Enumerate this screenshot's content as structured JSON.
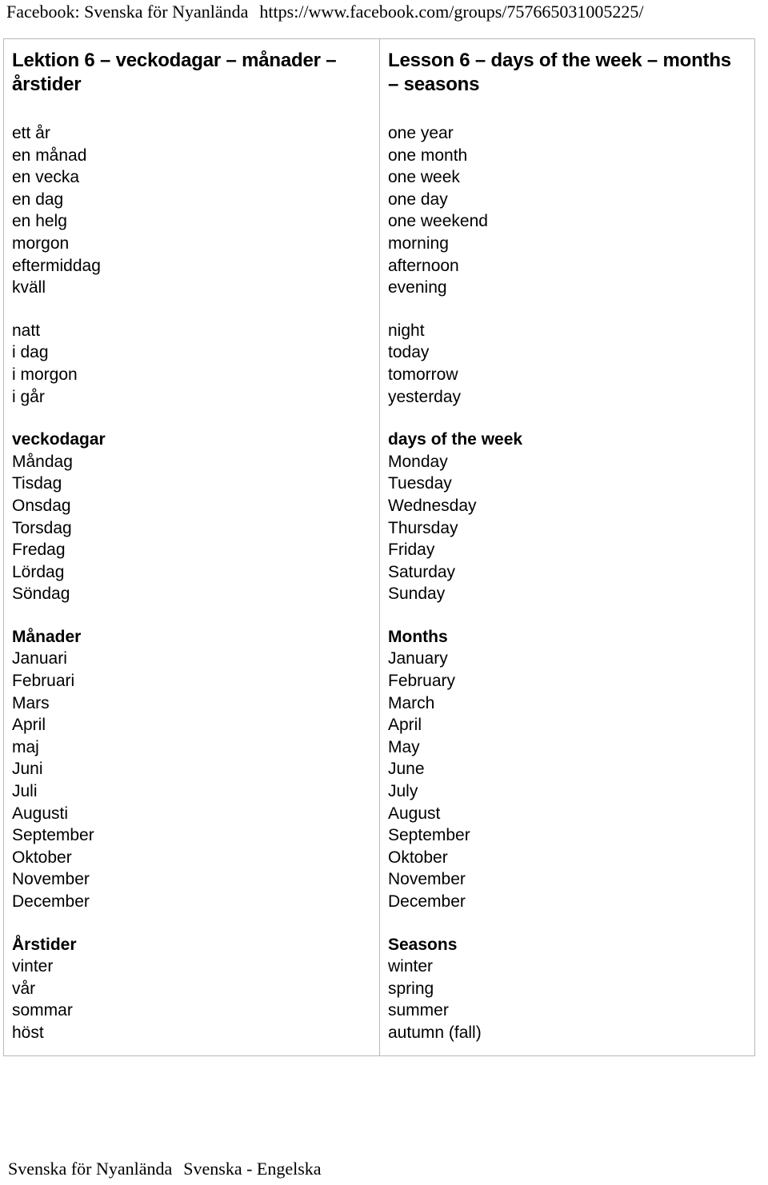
{
  "header": {
    "site_label": "Facebook: Svenska för Nyanlända",
    "url": "https://www.facebook.com/groups/757665031005225/"
  },
  "table": {
    "left_column": {
      "title": "Lektion 6 – veckodagar – månader – årstider",
      "blocks": [
        {
          "heading": null,
          "items": [
            "ett år",
            "en månad",
            "en vecka",
            "en dag",
            "en helg",
            "morgon",
            "eftermiddag",
            "kväll"
          ]
        },
        {
          "heading": null,
          "items": [
            "natt",
            "i dag",
            "i morgon",
            "i går"
          ]
        },
        {
          "heading": "veckodagar",
          "items": [
            "Måndag",
            "Tisdag",
            "Onsdag",
            "Torsdag",
            "Fredag",
            "Lördag",
            "Söndag"
          ]
        },
        {
          "heading": "Månader",
          "items": [
            "Januari",
            "Februari",
            "Mars",
            "April",
            "maj",
            "Juni",
            "Juli",
            "Augusti",
            "September",
            "Oktober",
            "November",
            "December"
          ]
        },
        {
          "heading": "Årstider",
          "items": [
            "vinter",
            "vår",
            "sommar",
            "höst"
          ]
        }
      ]
    },
    "right_column": {
      "title": "Lesson 6 – days of the week – months – seasons",
      "blocks": [
        {
          "heading": null,
          "items": [
            "one year",
            "one month",
            "one week",
            "one day",
            "one weekend",
            "morning",
            "afternoon",
            "evening"
          ]
        },
        {
          "heading": null,
          "items": [
            "night",
            "today",
            "tomorrow",
            "yesterday"
          ]
        },
        {
          "heading": "days of the week",
          "items": [
            "Monday",
            "Tuesday",
            "Wednesday",
            "Thursday",
            "Friday",
            "Saturday",
            "Sunday"
          ]
        },
        {
          "heading": "Months",
          "items": [
            "January",
            "February",
            "March",
            "April",
            "May",
            "June",
            "July",
            "August",
            "September",
            "Oktober",
            "November",
            "December"
          ]
        },
        {
          "heading": "Seasons",
          "items": [
            "winter",
            "spring",
            "summer",
            "autumn (fall)"
          ]
        }
      ]
    }
  },
  "footer": {
    "left_text": "Svenska för Nyanlända",
    "right_text": "Svenska - Engelska"
  },
  "colors": {
    "text": "#000000",
    "border": "#b8b8b8",
    "background": "#ffffff"
  }
}
